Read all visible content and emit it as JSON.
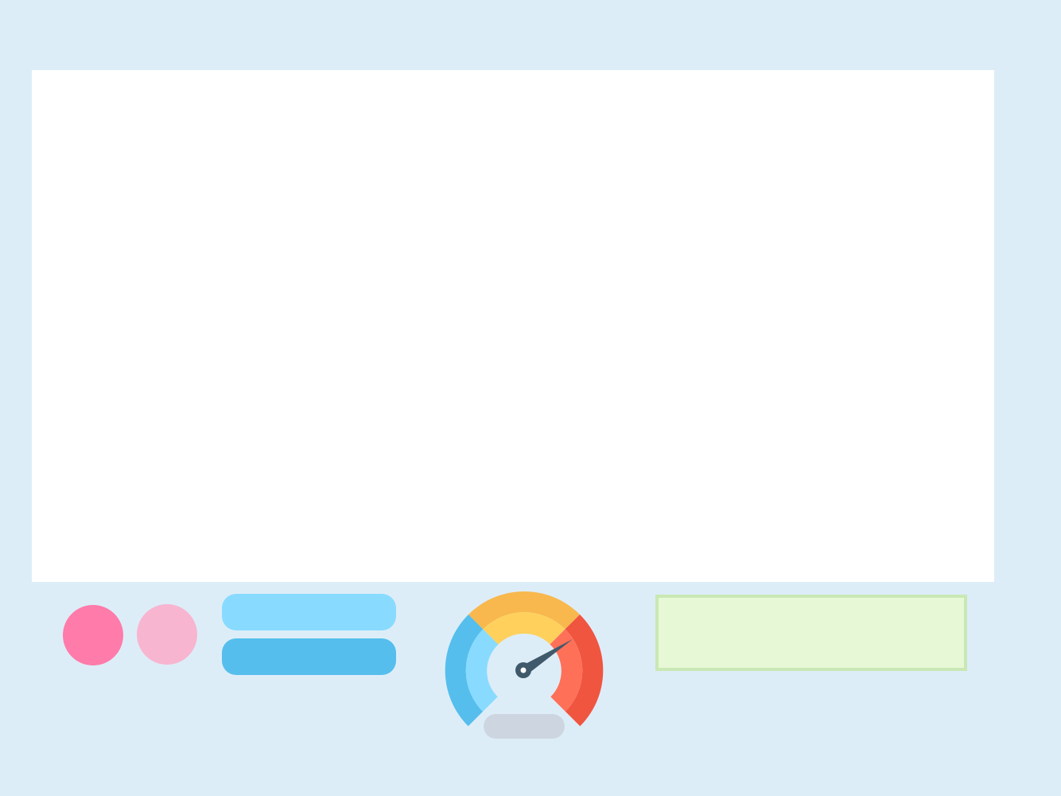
{
  "colors": {
    "background": "#DDEDF8",
    "screen": "#FFFFFF",
    "dot_primary": "#FF7BAA",
    "dot_secondary": "#F8B5D0",
    "pill_light": "#88DBFF",
    "pill_dark": "#55BEEC",
    "gauge_low_outer": "#55BEEC",
    "gauge_low_inner": "#88DBFF",
    "gauge_mid_outer": "#F8B84E",
    "gauge_mid_inner": "#FFD15C",
    "gauge_high_outer": "#F05540",
    "gauge_high_inner": "#FF7058",
    "gauge_needle": "#40596B",
    "gauge_base": "#CDD6E0",
    "note_fill": "#E7F8D6",
    "note_border": "#C9E8B4"
  },
  "icons": {
    "gauge": "speedometer-icon",
    "needle": "gauge-needle-icon"
  }
}
